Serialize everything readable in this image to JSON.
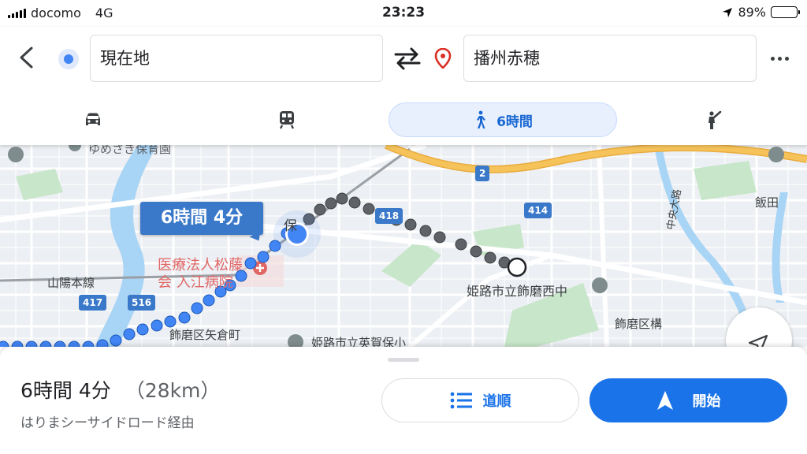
{
  "status_bar": {
    "carrier": "docomo",
    "network": "4G",
    "time": "23:23",
    "battery": "89%",
    "battery_level": 0.89
  },
  "search": {
    "origin": "現在地",
    "destination": "播州赤穂"
  },
  "travel_modes": {
    "walk_label": "6時間"
  },
  "map": {
    "route_callout": "6時間 4分",
    "labels": {
      "nursery": "ゆめさき保育園",
      "hospital_line1": "医療法人松藤",
      "hospital_line2": "会 入江病院",
      "sanyo_line": "山陽本線",
      "yagura": "飾磨区矢倉町",
      "eigahoiku": "姫路市立英賀保小",
      "school": "姫路市立飾磨西中",
      "shikama_kamae": "飾磨区構",
      "iida": "飯田",
      "chuo_odori": "中央大路",
      "ho": "保"
    },
    "shields": [
      "2",
      "418",
      "414",
      "417",
      "516"
    ]
  },
  "summary": {
    "duration": "6時間 4分",
    "distance": "（28km）",
    "via": "はりまシーサイドロード経由",
    "steps_label": "道順",
    "start_label": "開始"
  },
  "colors": {
    "accent": "#1a73e8",
    "route_blue": "#4285f4",
    "route_gray": "#5f6368",
    "highway": "#f6c35b",
    "water": "#a8d4f5",
    "park": "#c8e6c9"
  }
}
